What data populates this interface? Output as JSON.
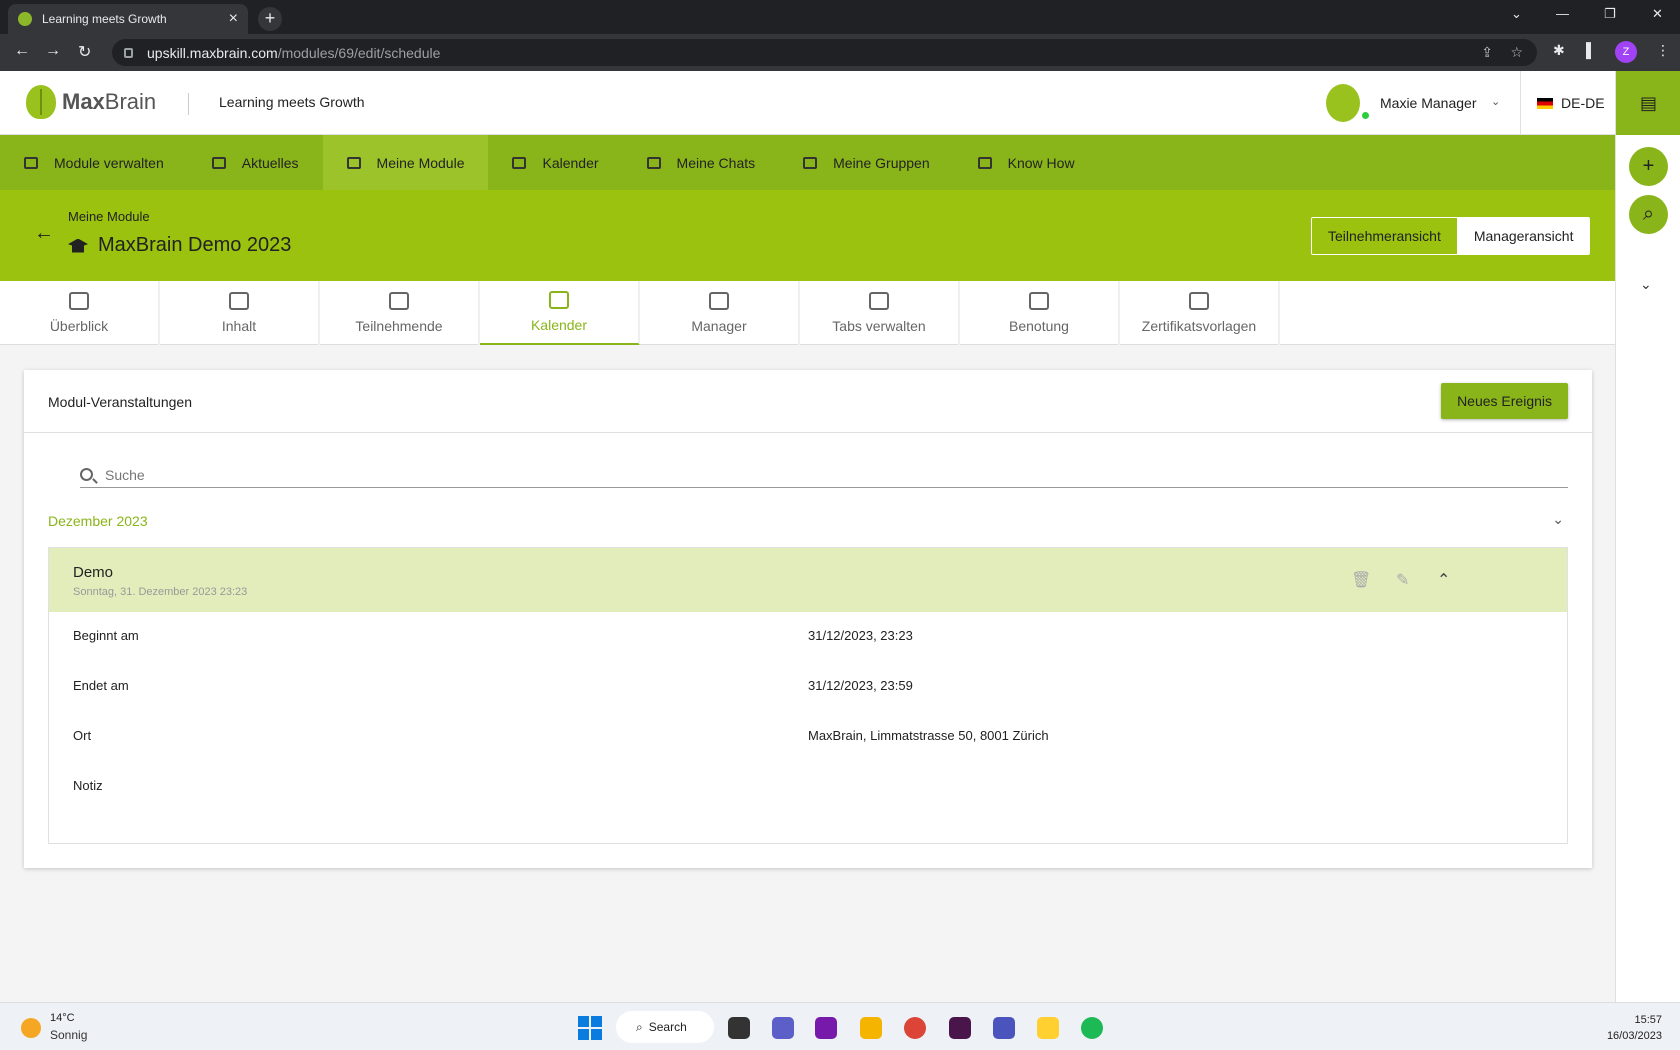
{
  "browser": {
    "tab_title": "Learning meets Growth",
    "url_host": "upskill.maxbrain.com",
    "url_path": "/modules/69/edit/schedule",
    "profile_initial": "Z"
  },
  "header": {
    "logo_text_bold": "Max",
    "logo_text_light": "Brain",
    "slogan": "Learning meets Growth",
    "user_name": "Maxie Manager",
    "language": "DE-DE"
  },
  "main_nav": [
    {
      "label": "Module verwalten",
      "icon": "module-manage-icon"
    },
    {
      "label": "Aktuelles",
      "icon": "news-icon"
    },
    {
      "label": "Meine Module",
      "icon": "graduation-cap-icon",
      "active": true
    },
    {
      "label": "Kalender",
      "icon": "calendar-icon"
    },
    {
      "label": "Meine Chats",
      "icon": "chat-icon"
    },
    {
      "label": "Meine Gruppen",
      "icon": "groups-icon"
    },
    {
      "label": "Know How",
      "icon": "book-icon"
    }
  ],
  "module": {
    "breadcrumb": "Meine Module",
    "title": "MaxBrain Demo 2023",
    "view_participant": "Teilnehmeransicht",
    "view_manager": "Manageransicht"
  },
  "sub_tabs": [
    {
      "label": "Überblick",
      "icon": "dashboard-icon"
    },
    {
      "label": "Inhalt",
      "icon": "folder-icon"
    },
    {
      "label": "Teilnehmende",
      "icon": "people-icon"
    },
    {
      "label": "Kalender",
      "icon": "calendar-icon",
      "active": true
    },
    {
      "label": "Manager",
      "icon": "manager-icon"
    },
    {
      "label": "Tabs verwalten",
      "icon": "tabs-icon"
    },
    {
      "label": "Benotung",
      "icon": "grade-icon"
    },
    {
      "label": "Zertifikatsvorlagen",
      "icon": "certificate-icon"
    }
  ],
  "schedule": {
    "title": "Modul-Veranstaltungen",
    "new_event": "Neues Ereignis",
    "search_placeholder": "Suche",
    "month": "Dezember 2023",
    "event": {
      "title": "Demo",
      "subtitle": "Sonntag, 31. Dezember 2023 23:23",
      "rows": [
        {
          "label": "Beginnt am",
          "value": "31/12/2023, 23:23"
        },
        {
          "label": "Endet am",
          "value": "31/12/2023, 23:59"
        },
        {
          "label": "Ort",
          "value": "MaxBrain, Limmatstrasse 50, 8001 Zürich"
        },
        {
          "label": "Notiz",
          "value": ""
        }
      ]
    }
  },
  "taskbar": {
    "temperature": "14°C",
    "condition": "Sonnig",
    "search": "Search",
    "time": "15:57",
    "date": "16/03/2023"
  },
  "colors": {
    "accent": "#8ab51a",
    "header_green": "#9ac20e",
    "event_bg": "#e3edbb"
  }
}
